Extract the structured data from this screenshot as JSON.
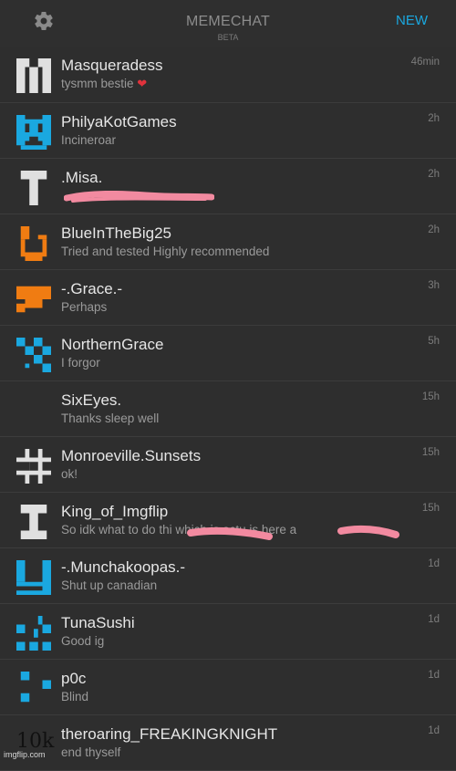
{
  "header": {
    "title": "MEMECHAT",
    "subtitle": "BETA",
    "new_label": "NEW",
    "settings_icon": "gear-icon"
  },
  "colors": {
    "background": "#2e2e2e",
    "accent": "#1aa8e0",
    "orange": "#f07c12",
    "blue": "#1aa8e0",
    "white": "#e0e0e0",
    "scribble": "#f28aa0"
  },
  "chats": [
    {
      "name": "Masqueradess",
      "preview": "tysmm bestie",
      "time": "46min",
      "avatar_color": "white",
      "emoji": "heart"
    },
    {
      "name": "PhilyaKotGames",
      "preview": "Incineroar",
      "time": "2h",
      "avatar_color": "blue"
    },
    {
      "name": ".Misa.",
      "preview": "",
      "time": "2h",
      "avatar_color": "white"
    },
    {
      "name": "BlueInTheBig25",
      "preview": "Tried and tested Highly recommended",
      "time": "2h",
      "avatar_color": "orange"
    },
    {
      "name": "-.Grace.-",
      "preview": "Perhaps",
      "time": "3h",
      "avatar_color": "orange"
    },
    {
      "name": "NorthernGrace",
      "preview": "I forgor",
      "time": "5h",
      "avatar_color": "blue"
    },
    {
      "name": "SixEyes.",
      "preview": "Thanks sleep well",
      "time": "15h",
      "avatar_color": "none"
    },
    {
      "name": "Monroeville.Sunsets",
      "preview": "ok!",
      "time": "15h",
      "avatar_color": "white"
    },
    {
      "name": "King_of_Imgflip",
      "preview": "So idk what to do thi which is actu is here a",
      "time": "15h",
      "avatar_color": "white"
    },
    {
      "name": "-.Munchakoopas.-",
      "preview": "Shut up canadian",
      "time": "1d",
      "avatar_color": "blue"
    },
    {
      "name": "TunaSushi",
      "preview": "Good ig",
      "time": "1d",
      "avatar_color": "blue"
    },
    {
      "name": "p0c",
      "preview": "Blind",
      "time": "1d",
      "avatar_color": "blue"
    },
    {
      "name": "theroaring_FREAKINGKNIGHT",
      "preview": "end thyself",
      "time": "1d",
      "avatar_color": "orange"
    }
  ],
  "watermark": {
    "big": "10k",
    "small": "imgflip.com"
  }
}
